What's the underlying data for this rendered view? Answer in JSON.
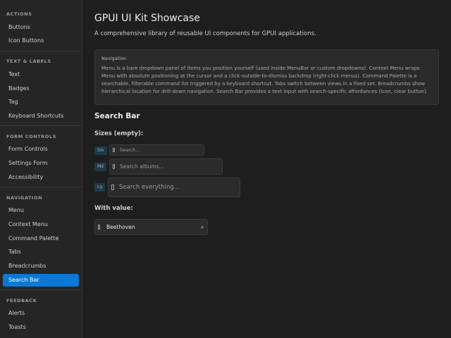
{
  "sidebar": {
    "sections": [
      {
        "label": "ACTIONS",
        "items": [
          "Buttons",
          "Icon Buttons"
        ]
      },
      {
        "label": "TEXT & LABELS",
        "items": [
          "Text",
          "Badges",
          "Tag",
          "Keyboard Shortcuts"
        ]
      },
      {
        "label": "FORM CONTROLS",
        "items": [
          "Form Controls",
          "Settings Form",
          "Accessibility"
        ]
      },
      {
        "label": "NAVIGATION",
        "items": [
          "Menu",
          "Context Menu",
          "Command Palette",
          "Tabs",
          "Breadcrumbs",
          "Search Bar"
        ]
      },
      {
        "label": "FEEDBACK",
        "items": [
          "Alerts",
          "Toasts"
        ]
      }
    ],
    "active_item": "Search Bar"
  },
  "main": {
    "title": "GPUI UI Kit Showcase",
    "subtitle": "A comprehensive library of reusable UI components for GPUI applications.",
    "info": {
      "title": "Navigation",
      "text": "Menu is a bare dropdown panel of items you position yourself (used inside MenuBar or custom dropdowns). Context Menu wraps Menu with absolute positioning at the cursor and a click-outside-to-dismiss backdrop (right-click menus). Command Palette is a searchable, filterable command list triggered by a keyboard shortcut. Tabs switch between views in a fixed set. Breadcrumbs show hierarchical location for drill-down navigation. Search Bar provides a text input with search-specific affordances (icon, clear button)."
    },
    "section_title": "Search Bar",
    "sizes_heading": "Sizes (empty):",
    "sizes": [
      {
        "badge": "Sm",
        "placeholder": "Search..."
      },
      {
        "badge": "Md",
        "placeholder": "Search albums..."
      },
      {
        "badge": "Lg",
        "placeholder": "Search everything..."
      }
    ],
    "value_heading": "With value:",
    "value_field": {
      "value": "Beethoven",
      "clear": "×"
    }
  }
}
